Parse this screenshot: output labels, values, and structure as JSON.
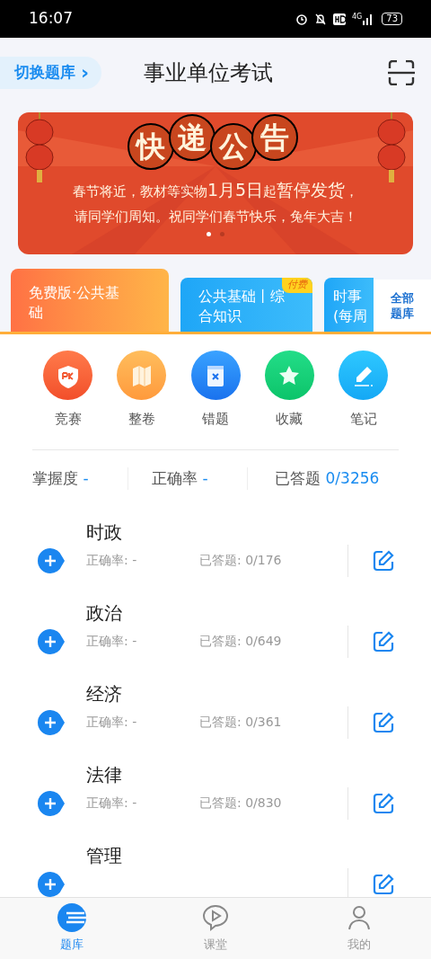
{
  "status_bar": {
    "time": "16:07",
    "battery": "73",
    "network": "4G"
  },
  "header": {
    "switch_button": "切换题库",
    "switch_caret": "›",
    "title": "事业单位考试"
  },
  "banner": {
    "title_chars": [
      "快",
      "递",
      "公",
      "告"
    ],
    "lines": [
      "春节将近，教材等实物**1月5日**起**暂停发货**，",
      "请同学们周知。祝同学们春节快乐，兔年大吉！"
    ],
    "dots": [
      {
        "selected": true
      },
      {
        "selected": false
      }
    ]
  },
  "bank_cards": [
    {
      "kind": "orange",
      "lines": [
        "免费版·公共基",
        "础"
      ]
    },
    {
      "kind": "blue",
      "lines": [
        "公共基础丨综",
        "合知识"
      ],
      "badge": "付费"
    },
    {
      "kind": "blue",
      "lines": [
        "时事",
        "(每周"
      ]
    }
  ],
  "all_banks": [
    "全部",
    "题库"
  ],
  "tools": [
    {
      "kind": "pk",
      "label": "竞赛"
    },
    {
      "kind": "paper",
      "label": "整卷"
    },
    {
      "kind": "wrong",
      "label": "错题"
    },
    {
      "kind": "star",
      "label": "收藏"
    },
    {
      "kind": "note",
      "label": "笔记"
    }
  ],
  "stats": [
    {
      "label": "掌握度",
      "value": "-"
    },
    {
      "label": "正确率",
      "value": "-"
    },
    {
      "label": "已答题",
      "value": "0/3256"
    }
  ],
  "subjects": [
    {
      "name": "时政",
      "accuracy": "正确率: -",
      "answered": "已答题: 0/176"
    },
    {
      "name": "政治",
      "accuracy": "正确率: -",
      "answered": "已答题: 0/649"
    },
    {
      "name": "经济",
      "accuracy": "正确率: -",
      "answered": "已答题: 0/361"
    },
    {
      "name": "法律",
      "accuracy": "正确率: -",
      "answered": "已答题: 0/830"
    },
    {
      "name": "管理"
    }
  ],
  "tab_bar": [
    {
      "kind": "bank",
      "label": "题库",
      "selected": true
    },
    {
      "kind": "class",
      "label": "课堂",
      "selected": false
    },
    {
      "kind": "me",
      "label": "我的",
      "selected": false
    }
  ]
}
